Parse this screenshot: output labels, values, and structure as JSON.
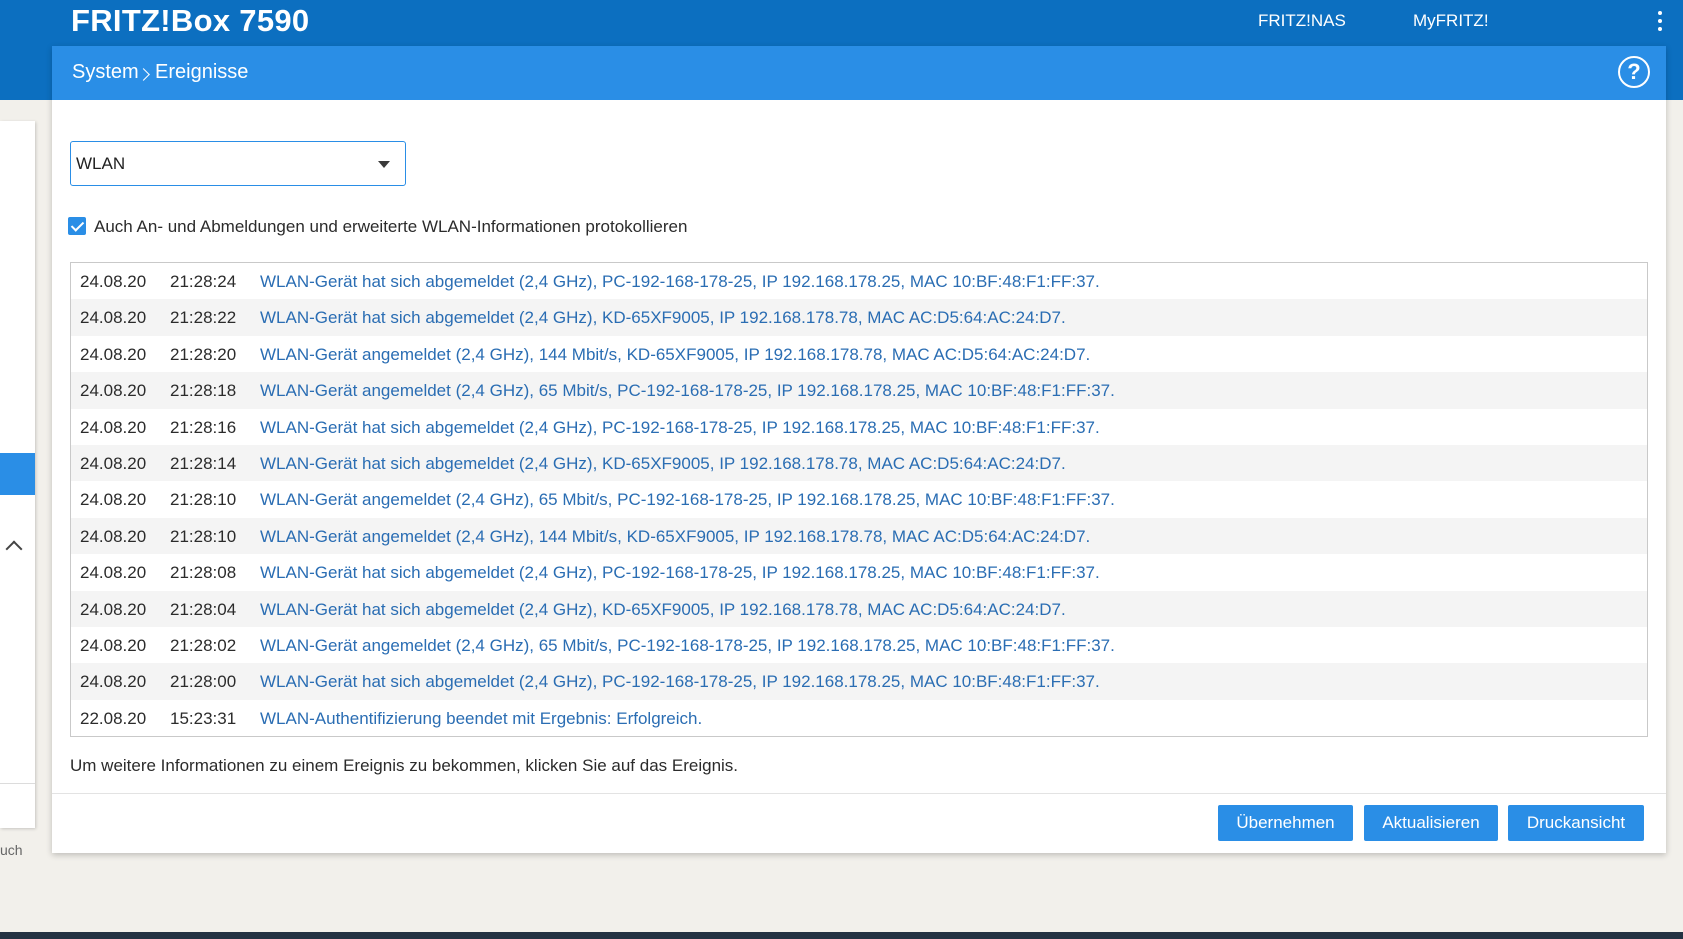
{
  "header": {
    "product": "FRITZ!Box 7590",
    "links": [
      "FRITZ!NAS",
      "MyFRITZ!"
    ],
    "menu_icon": "kebab-menu-icon"
  },
  "breadcrumb": {
    "parent": "System",
    "current": "Ereignisse",
    "help_label": "?"
  },
  "sidebar": {
    "footer_fragment": "uch"
  },
  "filter": {
    "selected": "WLAN",
    "checkbox_label": "Auch An- und Abmeldungen und erweiterte WLAN-Informationen protokollieren",
    "checkbox_checked": true
  },
  "events": [
    {
      "date": "24.08.20",
      "time": "21:28:24",
      "message": "WLAN-Gerät hat sich abgemeldet (2,4 GHz), PC-192-168-178-25, IP 192.168.178.25, MAC 10:BF:48:F1:FF:37."
    },
    {
      "date": "24.08.20",
      "time": "21:28:22",
      "message": "WLAN-Gerät hat sich abgemeldet (2,4 GHz), KD-65XF9005, IP 192.168.178.78, MAC AC:D5:64:AC:24:D7."
    },
    {
      "date": "24.08.20",
      "time": "21:28:20",
      "message": "WLAN-Gerät angemeldet (2,4 GHz), 144 Mbit/s, KD-65XF9005, IP 192.168.178.78, MAC AC:D5:64:AC:24:D7."
    },
    {
      "date": "24.08.20",
      "time": "21:28:18",
      "message": "WLAN-Gerät angemeldet (2,4 GHz), 65 Mbit/s, PC-192-168-178-25, IP 192.168.178.25, MAC 10:BF:48:F1:FF:37."
    },
    {
      "date": "24.08.20",
      "time": "21:28:16",
      "message": "WLAN-Gerät hat sich abgemeldet (2,4 GHz), PC-192-168-178-25, IP 192.168.178.25, MAC 10:BF:48:F1:FF:37."
    },
    {
      "date": "24.08.20",
      "time": "21:28:14",
      "message": "WLAN-Gerät hat sich abgemeldet (2,4 GHz), KD-65XF9005, IP 192.168.178.78, MAC AC:D5:64:AC:24:D7."
    },
    {
      "date": "24.08.20",
      "time": "21:28:10",
      "message": "WLAN-Gerät angemeldet (2,4 GHz), 65 Mbit/s, PC-192-168-178-25, IP 192.168.178.25, MAC 10:BF:48:F1:FF:37."
    },
    {
      "date": "24.08.20",
      "time": "21:28:10",
      "message": "WLAN-Gerät angemeldet (2,4 GHz), 144 Mbit/s, KD-65XF9005, IP 192.168.178.78, MAC AC:D5:64:AC:24:D7."
    },
    {
      "date": "24.08.20",
      "time": "21:28:08",
      "message": "WLAN-Gerät hat sich abgemeldet (2,4 GHz), PC-192-168-178-25, IP 192.168.178.25, MAC 10:BF:48:F1:FF:37."
    },
    {
      "date": "24.08.20",
      "time": "21:28:04",
      "message": "WLAN-Gerät hat sich abgemeldet (2,4 GHz), KD-65XF9005, IP 192.168.178.78, MAC AC:D5:64:AC:24:D7."
    },
    {
      "date": "24.08.20",
      "time": "21:28:02",
      "message": "WLAN-Gerät angemeldet (2,4 GHz), 65 Mbit/s, PC-192-168-178-25, IP 192.168.178.25, MAC 10:BF:48:F1:FF:37."
    },
    {
      "date": "24.08.20",
      "time": "21:28:00",
      "message": "WLAN-Gerät hat sich abgemeldet (2,4 GHz), PC-192-168-178-25, IP 192.168.178.25, MAC 10:BF:48:F1:FF:37."
    },
    {
      "date": "22.08.20",
      "time": "15:23:31",
      "message": "WLAN-Authentifizierung beendet mit Ergebnis: Erfolgreich."
    }
  ],
  "hint": "Um weitere Informationen zu einem Ereignis zu bekommen, klicken Sie auf das Ereignis.",
  "buttons": {
    "apply": "Übernehmen",
    "refresh": "Aktualisieren",
    "print": "Druckansicht"
  },
  "colors": {
    "header_blue": "#0c6fc0",
    "accent_blue": "#2a8ee6",
    "link_blue": "#2a6db3",
    "footer_dark": "#233242"
  }
}
